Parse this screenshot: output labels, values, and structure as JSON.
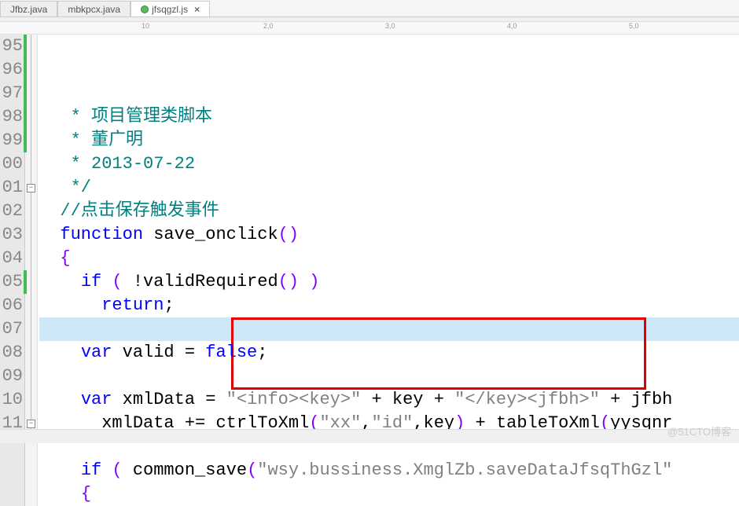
{
  "tabs": [
    {
      "label": "Jfbz.java",
      "active": false,
      "icon": null
    },
    {
      "label": "mbkpcx.java",
      "active": false,
      "icon": null
    },
    {
      "label": "jfsqgzl.js",
      "active": true,
      "icon": "green",
      "closeable": true
    }
  ],
  "ruler_marks": [
    {
      "pos": 180,
      "label": "10"
    },
    {
      "pos": 335,
      "label": "2,0"
    },
    {
      "pos": 490,
      "label": "3,0"
    },
    {
      "pos": 645,
      "label": "4,0"
    },
    {
      "pos": 800,
      "label": "5,0"
    }
  ],
  "line_numbers": [
    "95",
    "96",
    "97",
    "98",
    "99",
    "00",
    "01",
    "02",
    "03",
    "04",
    "05",
    "06",
    "07",
    "08",
    "09",
    "10",
    "11"
  ],
  "code_lines": {
    "l95": {
      "indent": "   ",
      "tokens": [
        {
          "cls": "s-comment",
          "t": "* 项目管理类脚本"
        }
      ]
    },
    "l96": {
      "indent": "   ",
      "tokens": [
        {
          "cls": "s-comment",
          "t": "* 董广明"
        }
      ]
    },
    "l97": {
      "indent": "   ",
      "tokens": [
        {
          "cls": "s-comment",
          "t": "* 2013-07-22"
        }
      ]
    },
    "l98": {
      "indent": "   ",
      "tokens": [
        {
          "cls": "s-comment",
          "t": "*/"
        }
      ]
    },
    "l99": {
      "indent": "  ",
      "tokens": [
        {
          "cls": "s-comment",
          "t": "//点击保存触发事件"
        }
      ]
    },
    "l100": {
      "indent": "  ",
      "tokens": [
        {
          "cls": "s-keyword",
          "t": "function"
        },
        {
          "cls": "",
          "t": " "
        },
        {
          "cls": "s-func",
          "t": "save_onclick"
        },
        {
          "cls": "s-paren",
          "t": "()"
        }
      ]
    },
    "l101": {
      "indent": "  ",
      "tokens": [
        {
          "cls": "s-paren",
          "t": "{"
        }
      ]
    },
    "l102": {
      "indent": "    ",
      "tokens": [
        {
          "cls": "s-keyword",
          "t": "if"
        },
        {
          "cls": "",
          "t": " "
        },
        {
          "cls": "s-paren",
          "t": "("
        },
        {
          "cls": "",
          "t": " "
        },
        {
          "cls": "s-punct",
          "t": "!"
        },
        {
          "cls": "s-ident",
          "t": "validRequired"
        },
        {
          "cls": "s-paren",
          "t": "()"
        },
        {
          "cls": "",
          "t": " "
        },
        {
          "cls": "s-paren",
          "t": ")"
        }
      ]
    },
    "l103": {
      "indent": "      ",
      "tokens": [
        {
          "cls": "s-keyword",
          "t": "return"
        },
        {
          "cls": "s-punct",
          "t": ";"
        }
      ]
    },
    "l104": {
      "indent": "",
      "tokens": []
    },
    "l105": {
      "indent": "    ",
      "tokens": [
        {
          "cls": "s-keyword",
          "t": "var"
        },
        {
          "cls": "",
          "t": " "
        },
        {
          "cls": "s-ident",
          "t": "valid"
        },
        {
          "cls": "",
          "t": " "
        },
        {
          "cls": "s-punct",
          "t": "="
        },
        {
          "cls": "",
          "t": " "
        },
        {
          "cls": "s-keyword",
          "t": "false"
        },
        {
          "cls": "s-punct",
          "t": ";"
        }
      ]
    },
    "l106": {
      "indent": "",
      "tokens": []
    },
    "l107": {
      "indent": "    ",
      "tokens": [
        {
          "cls": "s-keyword",
          "t": "var"
        },
        {
          "cls": "",
          "t": " "
        },
        {
          "cls": "s-ident",
          "t": "xmlData"
        },
        {
          "cls": "",
          "t": " "
        },
        {
          "cls": "s-punct",
          "t": "="
        },
        {
          "cls": "",
          "t": " "
        },
        {
          "cls": "s-string",
          "t": "\"<info><key>\""
        },
        {
          "cls": "",
          "t": " "
        },
        {
          "cls": "s-punct",
          "t": "+"
        },
        {
          "cls": "",
          "t": " "
        },
        {
          "cls": "s-ident",
          "t": "key"
        },
        {
          "cls": "",
          "t": " "
        },
        {
          "cls": "s-punct",
          "t": "+"
        },
        {
          "cls": "",
          "t": " "
        },
        {
          "cls": "s-string",
          "t": "\"</key><jfbh>\""
        },
        {
          "cls": "",
          "t": " "
        },
        {
          "cls": "s-punct",
          "t": "+"
        },
        {
          "cls": "",
          "t": " "
        },
        {
          "cls": "s-ident",
          "t": "jfbh"
        }
      ]
    },
    "l108": {
      "indent": "      ",
      "tokens": [
        {
          "cls": "s-ident",
          "t": "xmlData"
        },
        {
          "cls": "",
          "t": " "
        },
        {
          "cls": "s-punct",
          "t": "+="
        },
        {
          "cls": "",
          "t": " "
        },
        {
          "cls": "s-ident",
          "t": "ctrlToXml"
        },
        {
          "cls": "s-paren",
          "t": "("
        },
        {
          "cls": "s-string",
          "t": "\"xx\""
        },
        {
          "cls": "s-punct",
          "t": ","
        },
        {
          "cls": "s-string",
          "t": "\"id\""
        },
        {
          "cls": "s-punct",
          "t": ","
        },
        {
          "cls": "s-ident",
          "t": "key"
        },
        {
          "cls": "s-paren",
          "t": ")"
        },
        {
          "cls": "",
          "t": " "
        },
        {
          "cls": "s-punct",
          "t": "+"
        },
        {
          "cls": "",
          "t": " "
        },
        {
          "cls": "s-ident",
          "t": "tableToXml"
        },
        {
          "cls": "s-paren",
          "t": "("
        },
        {
          "cls": "s-ident",
          "t": "yysqnr"
        }
      ]
    },
    "l109": {
      "indent": "",
      "tokens": []
    },
    "l110": {
      "indent": "    ",
      "tokens": [
        {
          "cls": "s-keyword",
          "t": "if"
        },
        {
          "cls": "",
          "t": " "
        },
        {
          "cls": "s-paren",
          "t": "("
        },
        {
          "cls": "",
          "t": " "
        },
        {
          "cls": "s-ident",
          "t": "common_save"
        },
        {
          "cls": "s-paren",
          "t": "("
        },
        {
          "cls": "s-string",
          "t": "\"wsy.bussiness.XmglZb.saveDataJfsqThGzl\""
        }
      ]
    },
    "l111": {
      "indent": "    ",
      "tokens": [
        {
          "cls": "s-paren",
          "t": "{"
        }
      ]
    }
  },
  "highlighted_line_index": 9,
  "watermark": "@51CTO博客"
}
